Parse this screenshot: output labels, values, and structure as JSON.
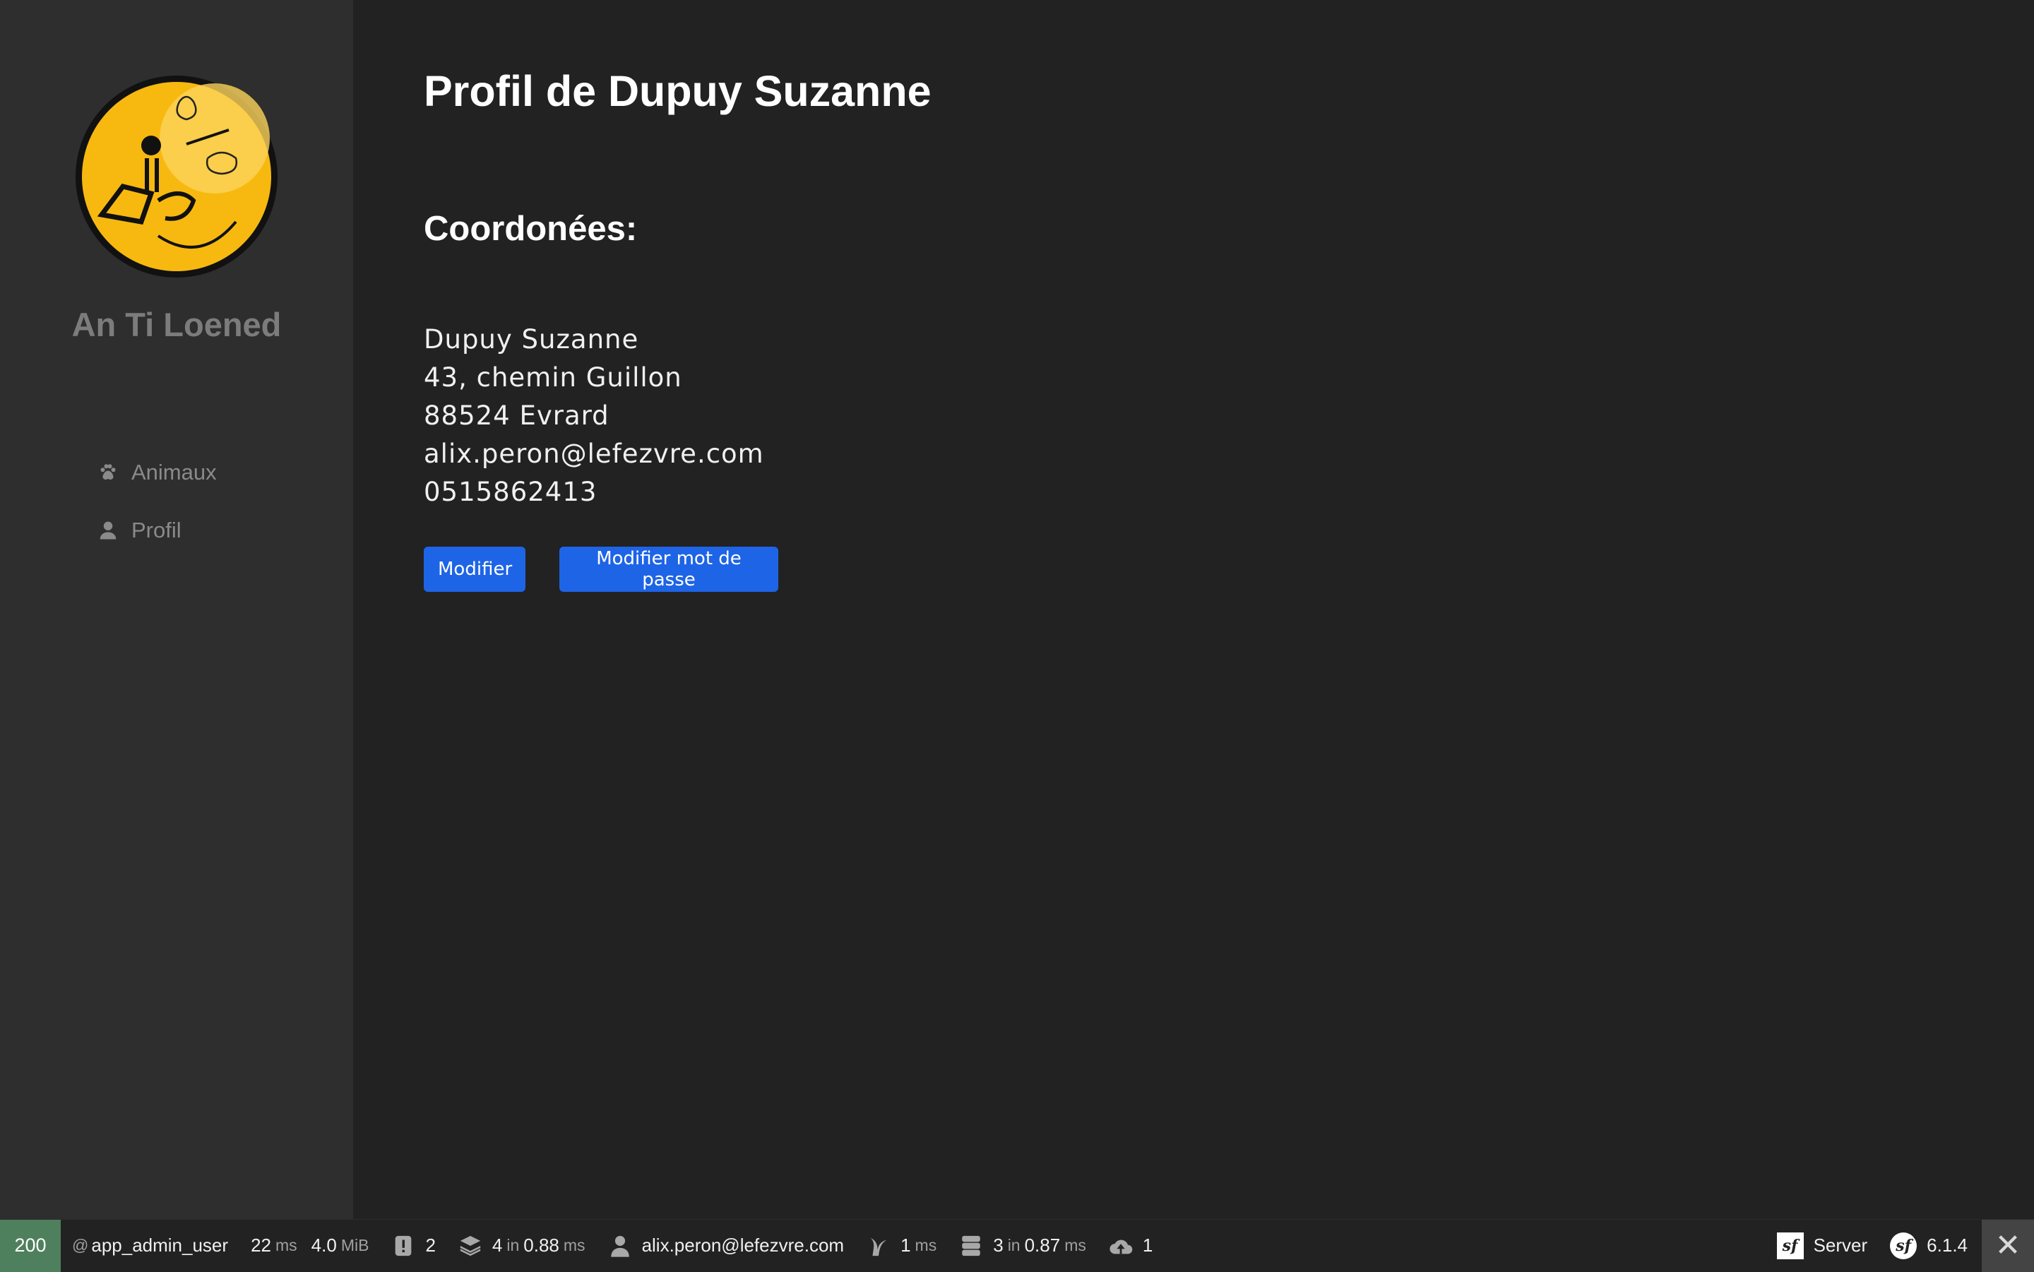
{
  "sidebar": {
    "brand": "An Ti Loened",
    "items": [
      {
        "label": "Animaux",
        "icon": "paw-icon"
      },
      {
        "label": "Profil",
        "icon": "user-icon"
      }
    ]
  },
  "main": {
    "title": "Profil de Dupuy Suzanne",
    "section_title": "Coordonées:",
    "contact": {
      "name": "Dupuy Suzanne",
      "street": "43, chemin Guillon",
      "city": "88524 Evrard",
      "email": "alix.peron@lefezvre.com",
      "phone": "0515862413"
    },
    "buttons": {
      "edit": "Modifier",
      "edit_password": "Modifier mot de passe"
    }
  },
  "toolbar": {
    "status_code": "200",
    "route_prefix": "@",
    "route": "app_admin_user",
    "time_value": "22",
    "time_unit": "ms",
    "memory_value": "4.0",
    "memory_unit": "MiB",
    "logs_count": "2",
    "cache_count": "4",
    "cache_in": "in",
    "cache_time": "0.88",
    "cache_unit": "ms",
    "user": "alix.peron@lefezvre.com",
    "twig_time": "1",
    "twig_unit": "ms",
    "db_count": "3",
    "db_in": "in",
    "db_time": "0.87",
    "db_unit": "ms",
    "upload_count": "1",
    "server_label": "Server",
    "symfony_version": "6.1.4",
    "close_glyph": "✕"
  },
  "colors": {
    "background": "#222222",
    "sidebar": "#2e2e2e",
    "primary_button": "#1e64e6",
    "status_ok": "#4f805d",
    "logo_yellow": "#f7b90f"
  }
}
